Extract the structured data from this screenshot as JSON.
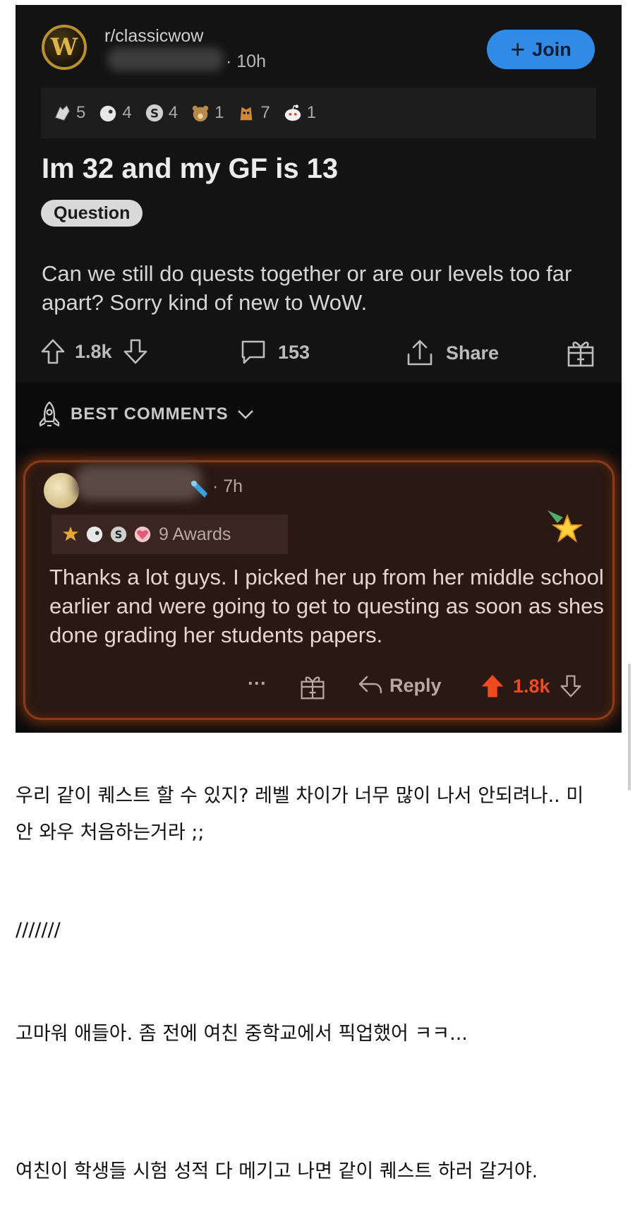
{
  "post": {
    "subreddit": "r/classicwow",
    "subreddit_logo_letter": "W",
    "time": "· 10h",
    "join_label": "Join",
    "join_plus": "+",
    "awards": [
      {
        "icon": "hands-award-icon",
        "count": "5",
        "color": "#d8d8d8"
      },
      {
        "icon": "cloud-award-icon",
        "count": "4",
        "color": "#e8e8e8"
      },
      {
        "icon": "silver-award-icon",
        "count": "4",
        "color": "#cfcfcf"
      },
      {
        "icon": "bear-award-icon",
        "count": "1",
        "color": "#b88a4a"
      },
      {
        "icon": "dog-award-icon",
        "count": "7",
        "color": "#d0893a"
      },
      {
        "icon": "snoo-award-icon",
        "count": "1",
        "color": "#f2f2f2"
      }
    ],
    "title": "Im 32 and my GF is 13",
    "flair": "Question",
    "body": "Can we still do quests together or are our levels too far apart? Sorry kind of new to WoW.",
    "upvotes": "1.8k",
    "comments": "153",
    "share_label": "Share"
  },
  "best_comments_label": "BEST COMMENTS",
  "comment": {
    "time": "· 7h",
    "awards_text": "9 Awards",
    "body": "Thanks a lot guys. I picked her up from her middle school earlier and were going to get to questing as soon as shes done grading her students papers.",
    "more": "···",
    "reply_label": "Reply",
    "score": "1.8k"
  },
  "captions": [
    "우리 같이 퀘스트 할 수 있지? 레벨 차이가 너무 많이 나서 안되려나.. 미",
    "안 와우 처음하는거라 ;;",
    "///////",
    "고마워 애들아. 좀 전에 여친 중학교에서 픽업했어 ㅋㅋ...",
    "여친이 학생들 시험 성적 다 메기고 나면 같이 퀘스트 하러 갈거야."
  ],
  "colors": {
    "accent_blue": "#2f8be6",
    "upvote_orange": "#f04a1e",
    "comment_glow": "#8a3a18"
  }
}
